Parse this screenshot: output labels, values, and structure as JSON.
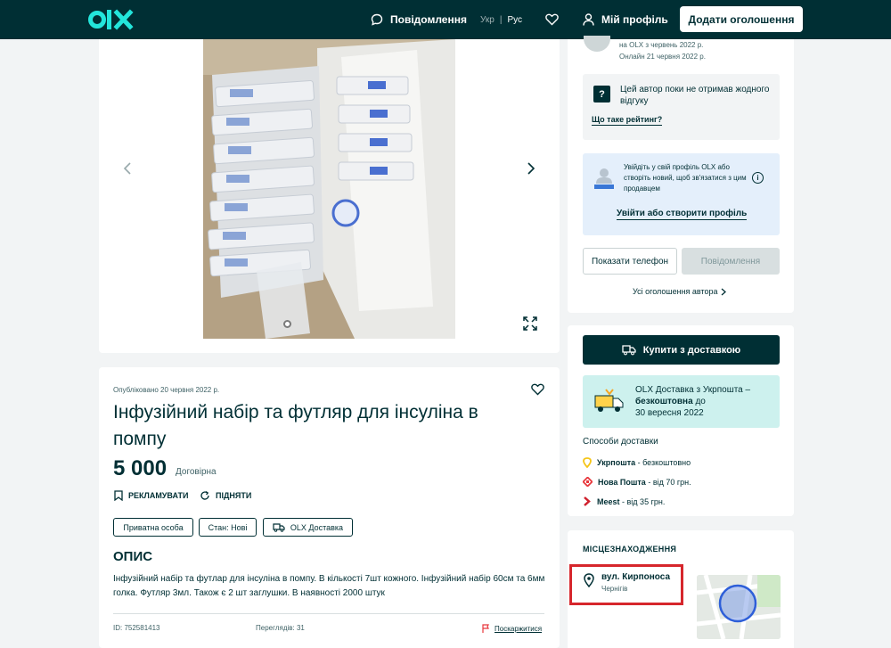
{
  "header": {
    "logo": "olx-logo",
    "messages_label": "Повідомлення",
    "lang_ukr": "Укр",
    "lang_sep": "|",
    "lang_rus": "Рус",
    "profile_label": "Мій профіль",
    "add_button": "Додати оголошення"
  },
  "listing": {
    "published": "Опубліковано 20 червня 2022 р.",
    "title": "Інфузійний набір та футляр для інсуліна в помпу",
    "price": "5 000",
    "price_note": "Договірна",
    "promote_label": "РЕКЛАМУВАТИ",
    "raise_label": "ПІДНЯТИ",
    "tags": [
      "Приватна особа",
      "Стан: Нові",
      "OLX Доставка"
    ],
    "description_title": "ОПИС",
    "description": "Інфузійний набір та футлар для інсуліна в помпу. В кількості 7шт кожного. Інфузійний набір 60см та 6мм голка. Футляр 3мл. Також є 2 шт заглушки. В наявності 2000 штук",
    "id_label": "ID: 752581413",
    "views_label": "Переглядів: 31",
    "report_label": "Поскаржитися"
  },
  "seller": {
    "on_olx": "на OLX з червень 2022 р.",
    "online": "Онлайн 21 червня 2022 р.",
    "rating_text": "Цей автор поки не отримав жодного відгуку",
    "rating_link": "Що таке рейтинг?",
    "login_text": "Увійдіть у свій профіль OLX або створіть новий, щоб зв'язатися з цим продавцем",
    "login_link": "Увійти або створити профіль",
    "show_phone": "Показати телефон",
    "message_button": "Повідомлення",
    "all_ads": "Усі оголошення автора"
  },
  "delivery": {
    "buy_button": "Купити з доставкою",
    "promo_line1": "OLX Доставка з Укрпошта –",
    "promo_bold": "безкоштовна",
    "promo_line2": "до",
    "promo_line3": "30 вересня 2022",
    "methods_title": "Способи доставки",
    "methods": [
      {
        "name": "Укрпошта",
        "detail": "- безкоштовно",
        "color": "#f5c518"
      },
      {
        "name": "Нова Пошта",
        "detail": "- від 70 грн.",
        "color": "#e8383d"
      },
      {
        "name": "Meest",
        "detail": "- від 35 грн.",
        "color": "#d0202d"
      }
    ]
  },
  "location": {
    "title": "МІСЦЕЗНАХОДЖЕННЯ",
    "street": "вул. Кирпоноса",
    "city": "Чернігів"
  },
  "colors": {
    "primary": "#002f34",
    "teal": "#23e5db",
    "highlight": "#d6262c",
    "background": "#f2f4f5"
  }
}
